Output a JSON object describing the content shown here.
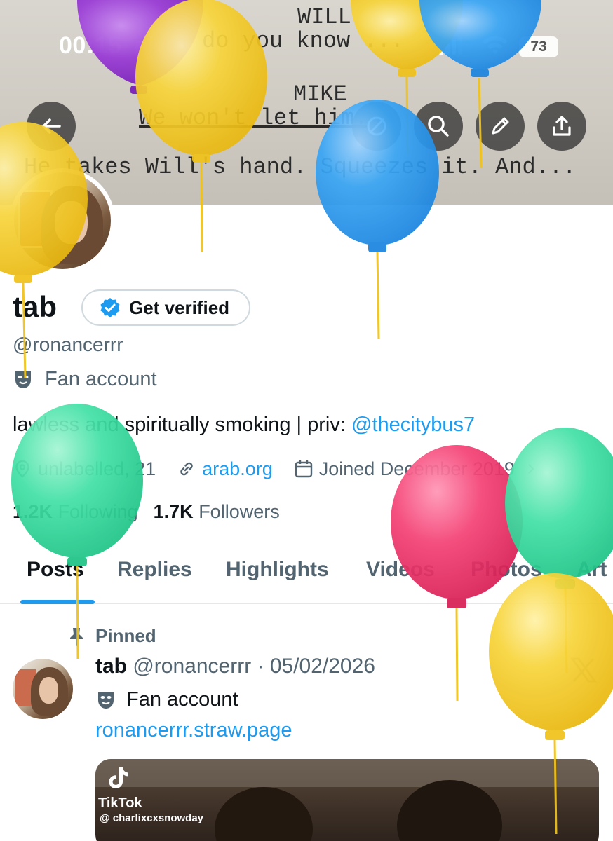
{
  "status_bar": {
    "time": "00:15",
    "battery": "73"
  },
  "header": {
    "script_lines": [
      "WILL",
      "do you know ...",
      "MIKE",
      "We won't let him.",
      "He takes Will's hand. Squeezes it. And..."
    ],
    "back_icon": "back-arrow-icon",
    "action_icons": [
      "no-pencil-icon",
      "search-icon",
      "edit-icon",
      "share-icon"
    ]
  },
  "profile": {
    "name": "tab",
    "get_verified_label": "Get verified",
    "handle": "@ronancerrr",
    "category": "Fan account",
    "bio_text": "lawless and spiritually smoking | priv: ",
    "bio_mention": "@thecitybus7",
    "location": "unlabelled, 21",
    "website": "arab.org",
    "joined": "Joined December 2019",
    "following_count": "1.2K",
    "following_label": "Following",
    "followers_count": "1.7K",
    "followers_label": "Followers"
  },
  "tabs": [
    "Posts",
    "Replies",
    "Highlights",
    "Videos",
    "Photos",
    "Art"
  ],
  "active_tab": "Posts",
  "pinned_post": {
    "pinned_label": "Pinned",
    "name": "tab",
    "meta": "@ronancerrr · 05/02/2026",
    "category": "Fan account",
    "link": "ronancerrr.straw.page",
    "media": {
      "watermark": "TikTok",
      "watermark_user": "@ charlixcxsnowday"
    }
  },
  "colors": {
    "accent": "#1d9bf0",
    "balloon_yellow": "#f5cd2f",
    "balloon_blue": "#2f9ff0",
    "balloon_purple": "#9b3fd6",
    "balloon_green": "#3de0a3",
    "balloon_red": "#f0376a"
  }
}
